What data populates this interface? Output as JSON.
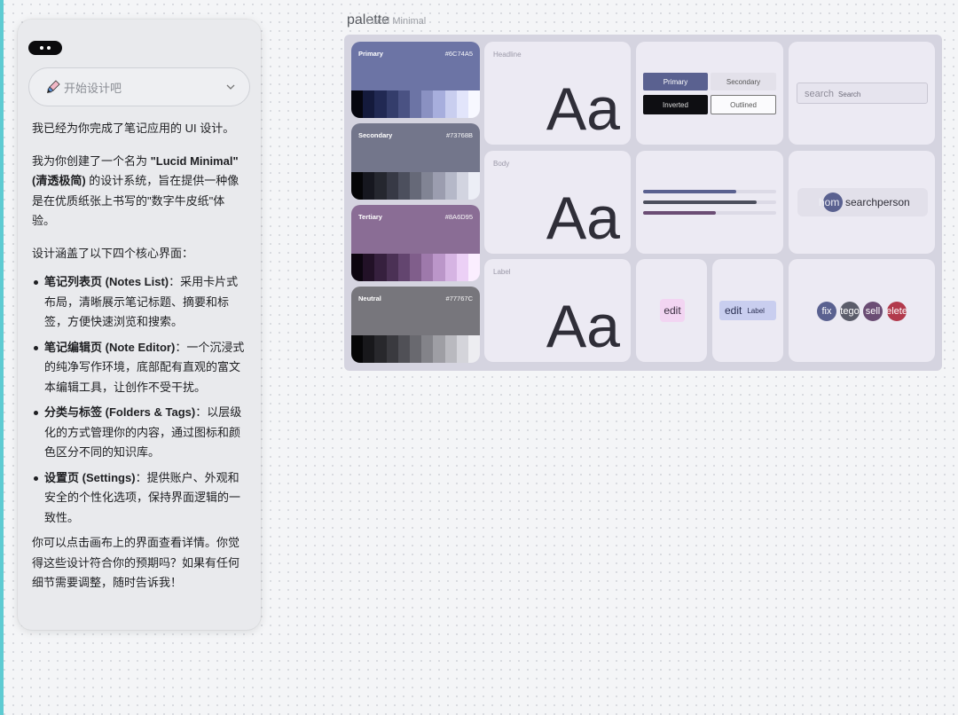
{
  "chat": {
    "select_label": "开始设计吧",
    "p1": "我已经为你完成了笔记应用的 UI 设计。",
    "p2_before": "我为你创建了一个名为 ",
    "p2_bold": "\"Lucid Minimal\" (清透极简)",
    "p2_after": " 的设计系统，旨在提供一种像是在优质纸张上书写的\"数字牛皮纸\"体验。",
    "p3": "设计涵盖了以下四个核心界面：",
    "items": [
      {
        "title": "笔记列表页 (Notes List)",
        "text": "：采用卡片式布局，清晰展示笔记标题、摘要和标签，方便快速浏览和搜索。"
      },
      {
        "title": "笔记编辑页 (Note Editor)",
        "text": "：一个沉浸式的纯净写作环境，底部配有直观的富文本编辑工具，让创作不受干扰。"
      },
      {
        "title": "分类与标签 (Folders & Tags)",
        "text": "：以层级化的方式管理你的内容，通过图标和颜色区分不同的知识库。"
      },
      {
        "title": "设置页 (Settings)",
        "text": "：提供账户、外观和安全的个性化选项，保持界面逻辑的一致性。"
      }
    ],
    "p4": "你可以点击画布上的界面查看详情。你觉得这些设计符合你的预期吗？如果有任何细节需要调整，随时告诉我！"
  },
  "canvas": {
    "frame_title": "palette",
    "frame_subtitle": "Lucid Minimal",
    "swatches": [
      {
        "name": "Primary",
        "hex": "#6C74A5",
        "color": "#6c74a5",
        "ramp": [
          "#06060f",
          "#141a3c",
          "#212953",
          "#343d6b",
          "#4a5283",
          "#6c74a5",
          "#8a91c2",
          "#a7aedd",
          "#c9ceef",
          "#e2e5fb",
          "#f7f8ff"
        ]
      },
      {
        "name": "Secondary",
        "hex": "#73768B",
        "color": "#73768b",
        "ramp": [
          "#050507",
          "#16171f",
          "#25272f",
          "#373945",
          "#4c4f5d",
          "#666978",
          "#818494",
          "#9b9daf",
          "#b5b8c8",
          "#d2d4e0",
          "#eceef6"
        ]
      },
      {
        "name": "Tertiary",
        "hex": "#8A6D95",
        "color": "#8a6d95",
        "ramp": [
          "#0c050f",
          "#221127",
          "#36203e",
          "#4b3155",
          "#63456f",
          "#805e8b",
          "#9e79ab",
          "#bb96c9",
          "#d6b4e3",
          "#ecd0f6",
          "#fbeeff"
        ]
      },
      {
        "name": "Neutral",
        "hex": "#77767C",
        "color": "#77767c",
        "ramp": [
          "#060607",
          "#18181b",
          "#28282c",
          "#3a3a3f",
          "#505056",
          "#69696f",
          "#838389",
          "#9e9ea4",
          "#b9b9bf",
          "#d4d4da",
          "#ededf1"
        ]
      }
    ],
    "type_labels": [
      "Headline",
      "Body",
      "Label"
    ],
    "type_sample": "Aa",
    "buttons": {
      "primary": "Primary",
      "secondary": "Secondary",
      "inverted": "Inverted",
      "outlined": "Outlined"
    },
    "search": {
      "placeholder": "search",
      "label": "Search"
    },
    "chip": {
      "avatar_text": "hom",
      "text": "searchperson"
    },
    "edit_fab": "edit",
    "edit_ext": {
      "icon": "edit",
      "label": "Label"
    },
    "icon_buttons": [
      "fix",
      "tego",
      "sell",
      "elete"
    ],
    "colors": {
      "accent": "#5ecbd2",
      "primary": "#6c74a5",
      "panel": "#e9eaed",
      "board": "#d5d4e0"
    }
  }
}
